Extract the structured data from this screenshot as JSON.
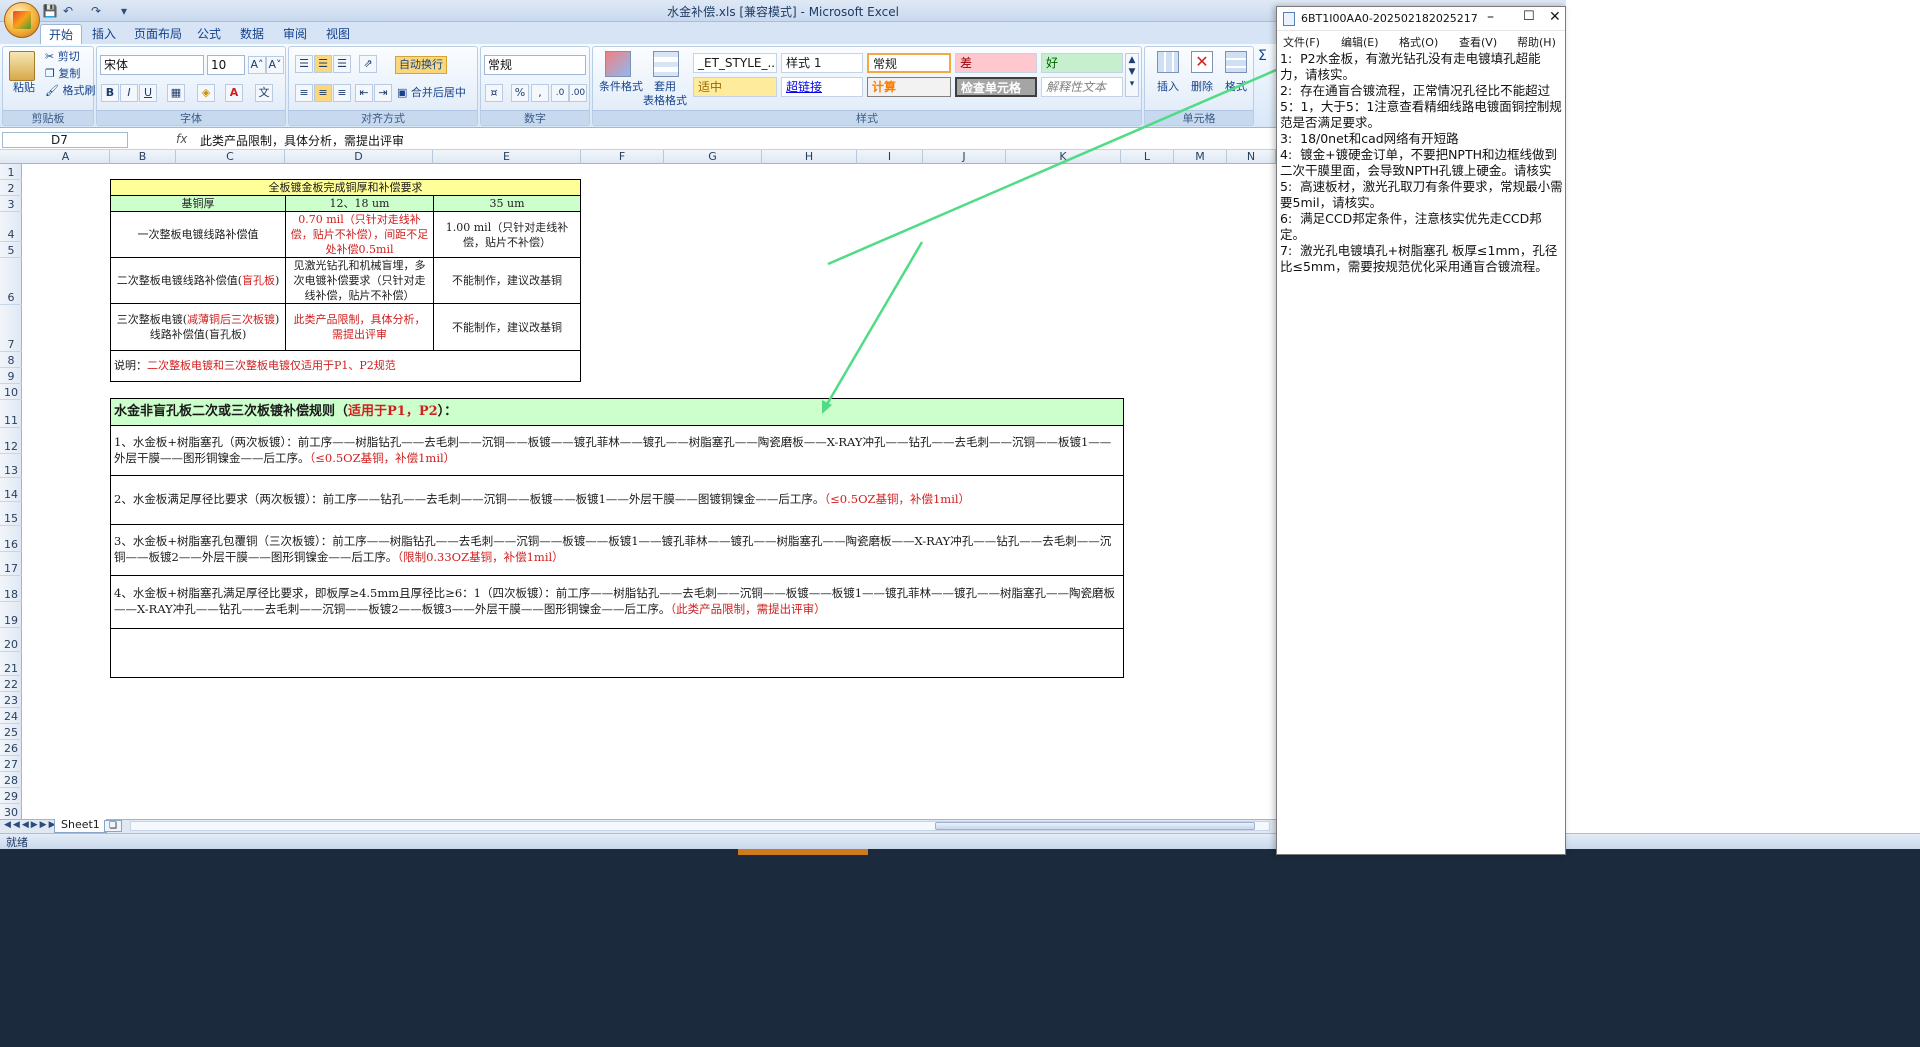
{
  "window": {
    "title": "水金补偿.xls  [兼容模式] - Microsoft Excel"
  },
  "ribbon_tabs": [
    "开始",
    "插入",
    "页面布局",
    "公式",
    "数据",
    "审阅",
    "视图"
  ],
  "ribbon": {
    "clipboard": {
      "paste": "粘贴",
      "cut": "剪切",
      "copy": "复制",
      "format_painter": "格式刷",
      "label": "剪贴板"
    },
    "font": {
      "name": "宋体",
      "size": "10",
      "label": "字体"
    },
    "alignment": {
      "wrap": "自动换行",
      "merge": "合并后居中",
      "label": "对齐方式"
    },
    "number": {
      "format": "常规",
      "percent": "%",
      "comma": ",",
      "label": "数字"
    },
    "styles": {
      "conditional": "条件格式",
      "table_format": "套用\n表格格式",
      "cells": [
        "_ET_STYLE_...",
        "样式 1",
        "常规",
        "差",
        "好",
        "适中",
        "超链接",
        "计算",
        "检查单元格",
        "解释性文本"
      ],
      "label": "样式"
    },
    "cells_group": {
      "insert": "插入",
      "delete": "删除",
      "format": "格式",
      "label": "单元格"
    },
    "colors": {
      "bad_bg": "#ffc7ce",
      "good_bg": "#c6efce",
      "neutral_bg": "#ffeb9c",
      "calc_color": "#fa7d00",
      "check_bg": "#a5a5a5"
    }
  },
  "formula_bar": {
    "name_box": "D7",
    "fx": "fx",
    "content": "此类产品限制，具体分析，需提出评审"
  },
  "columns": [
    "A",
    "B",
    "C",
    "D",
    "E",
    "F",
    "G",
    "H",
    "I",
    "J",
    "K",
    "L",
    "M",
    "N"
  ],
  "rows": [
    "1",
    "2",
    "3",
    "4",
    "5",
    "6",
    "7",
    "8",
    "9",
    "10",
    "11",
    "12",
    "13",
    "14",
    "15",
    "16",
    "17",
    "18",
    "19",
    "20",
    "21",
    "22",
    "23",
    "24",
    "25",
    "26",
    "27",
    "28",
    "29",
    "30"
  ],
  "table1": {
    "title": "全板镀金板完成铜厚和补偿要求",
    "headers": [
      "基铜厚",
      "12、18 um",
      "35 um"
    ],
    "rows": [
      {
        "label": "一次整板电镀线路补偿值",
        "label_red": "",
        "label_tail": "",
        "c12": "0.70 mil（只针对走线补偿，贴片不补偿），间距不足处补偿0.5mil",
        "c12_red": true,
        "c35": "1.00 mil（只针对走线补偿，贴片不补偿）"
      },
      {
        "label": "二次整板电镀线路补偿值(",
        "label_red": "盲孔板",
        "label_tail": ")",
        "c12": "见激光钻孔和机械盲埋，多次电镀补偿要求（只针对走线补偿，贴片不补偿）",
        "c12_red": false,
        "c35": "不能制作，建议改基铜"
      },
      {
        "label": "三次整板电镀(",
        "label_red": "减薄铜后三次板镀",
        "label_tail": ")线路补偿值(盲孔板)",
        "c12": "此类产品限制，具体分析，需提出评审",
        "c12_red": true,
        "c35": "不能制作，建议改基铜"
      }
    ],
    "note_prefix": "说明：",
    "note_red": "二次整板电镀和三次整板电镀仅适用于P1、P2规范"
  },
  "table2": {
    "title": "水金非盲孔板二次或三次板镀补偿规则（",
    "title_red": "适用于P1，P2",
    "title_tail": "）：",
    "rules": [
      {
        "text": "1、水金板+树脂塞孔（两次板镀）：前工序——树脂钻孔——去毛刺——沉铜——板镀——镀孔菲林——镀孔——树脂塞孔——陶瓷磨板——X-RAY冲孔——钻孔——去毛刺——沉铜——板镀1——外层干膜——图形铜镍金——后工序。",
        "red": "（≤0.5OZ基铜，补偿1mil）"
      },
      {
        "text": "2、水金板满足厚径比要求（两次板镀）：前工序——钻孔——去毛刺——沉铜——板镀——板镀1——外层干膜——图镀铜镍金——后工序。",
        "red": "（≤0.5OZ基铜，补偿1mil）"
      },
      {
        "text": "3、水金板+树脂塞孔包覆铜（三次板镀）：前工序——树脂钻孔——去毛刺——沉铜——板镀——板镀1——镀孔菲林——镀孔——树脂塞孔——陶瓷磨板——X-RAY冲孔——钻孔——去毛刺——沉铜——板镀2——外层干膜——图形铜镍金——后工序。",
        "red": "（限制0.33OZ基铜，补偿1mil）"
      },
      {
        "text": "4、水金板+树脂塞孔满足厚径比要求，即板厚≥4.5mm且厚径比≥6：1（四次板镀）：前工序——树脂钻孔——去毛刺——沉铜——板镀——板镀1——镀孔菲林——镀孔——树脂塞孔——陶瓷磨板——X-RAY冲孔——钻孔——去毛刺——沉铜——板镀2——板镀3——外层干膜——图形铜镍金——后工序。",
        "red": "（此类产品限制，需提出评审）"
      }
    ]
  },
  "sheet_tabs": [
    "Sheet1"
  ],
  "status": "就绪",
  "notepad": {
    "title": "6BT1I00AA0-20250218202521717...",
    "menu": [
      "文件(F)",
      "编辑(E)",
      "格式(O)",
      "查看(V)",
      "帮助(H)"
    ],
    "text": "1:  P2水金板，有激光钻孔没有走电镀填孔超能力，请核实。\n2:  存在通盲合镀流程，正常情况孔径比不能超过5：1，大于5：1注意查看精细线路电镀面铜控制规范是否满足要求。\n3:  18/0net和cad网络有开短路\n4:  镀金+镀硬金订单，不要把NPTH和边框线做到二次干膜里面，会导致NPTH孔镀上硬金。请核实\n5:  高速板材，激光孔取刀有条件要求，常规最小需要5mil，请核实。\n6:  满足CCD邦定条件，注意核实优先走CCD邦定。\n7:  激光孔电镀填孔+树脂塞孔 板厚≤1mm，孔径比≤5mm，需要按规范优化采用通盲合镀流程。"
  },
  "annotation_color": "#4fdc84"
}
